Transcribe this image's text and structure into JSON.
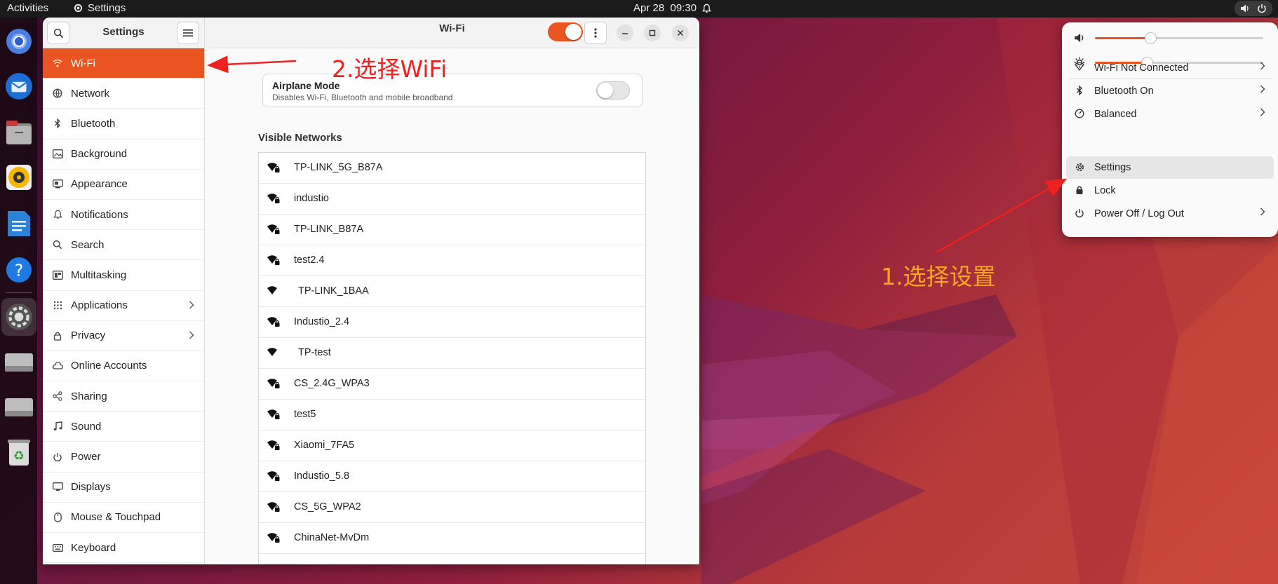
{
  "colors": {
    "accent": "#e95420",
    "annotation_red": "#ee2020",
    "annotation_yellow": "#f5a623"
  },
  "topbar": {
    "activities": "Activities",
    "app_name": "Settings",
    "clock": "Apr 28  09:30"
  },
  "dock": {
    "items": [
      "chromium-icon",
      "thunderbird-icon",
      "files-icon",
      "rhythmbox-icon",
      "writer-icon",
      "help-icon",
      "settings-icon",
      "drive-icon",
      "drive-icon",
      "trash-icon"
    ]
  },
  "settings": {
    "sidebar_title": "Settings",
    "nav": [
      {
        "label": "Wi-Fi",
        "icon": "wifi-icon",
        "active": true
      },
      {
        "label": "Network",
        "icon": "network-icon"
      },
      {
        "label": "Bluetooth",
        "icon": "bluetooth-icon"
      },
      {
        "label": "Background",
        "icon": "background-icon"
      },
      {
        "label": "Appearance",
        "icon": "appearance-icon"
      },
      {
        "label": "Notifications",
        "icon": "bell-icon"
      },
      {
        "label": "Search",
        "icon": "search-icon"
      },
      {
        "label": "Multitasking",
        "icon": "multitasking-icon"
      },
      {
        "label": "Applications",
        "icon": "grid-icon",
        "chevron": true
      },
      {
        "label": "Privacy",
        "icon": "lock-icon",
        "chevron": true
      },
      {
        "label": "Online Accounts",
        "icon": "cloud-icon"
      },
      {
        "label": "Sharing",
        "icon": "share-icon"
      },
      {
        "label": "Sound",
        "icon": "music-icon"
      },
      {
        "label": "Power",
        "icon": "power-icon"
      },
      {
        "label": "Displays",
        "icon": "display-icon"
      },
      {
        "label": "Mouse & Touchpad",
        "icon": "mouse-icon"
      },
      {
        "label": "Keyboard",
        "icon": "keyboard-icon"
      }
    ],
    "main_title": "Wi-Fi",
    "wifi_enabled": true,
    "airplane": {
      "title": "Airplane Mode",
      "subtitle": "Disables Wi-Fi, Bluetooth and mobile broadband",
      "enabled": false
    },
    "visible_networks_title": "Visible Networks",
    "networks": [
      {
        "name": "TP-LINK_5G_B87A",
        "secured": true
      },
      {
        "name": "industio",
        "secured": true
      },
      {
        "name": "TP-LINK_B87A",
        "secured": true
      },
      {
        "name": "test2.4",
        "secured": true
      },
      {
        "name": "TP-LINK_1BAA",
        "secured": false
      },
      {
        "name": "Industio_2.4",
        "secured": true
      },
      {
        "name": "TP-test",
        "secured": false
      },
      {
        "name": "CS_2.4G_WPA3",
        "secured": true
      },
      {
        "name": "test5",
        "secured": true
      },
      {
        "name": "Xiaomi_7FA5",
        "secured": true
      },
      {
        "name": "Industio_5.8",
        "secured": true
      },
      {
        "name": "CS_5G_WPA2",
        "secured": true
      },
      {
        "name": "ChinaNet-MvDm",
        "secured": true
      }
    ]
  },
  "quick_settings": {
    "volume_level": 0.33,
    "brightness_level": 0.31,
    "items": [
      {
        "label": "Wi-Fi Not Connected",
        "icon": "wifi-outline-icon",
        "chevron": true
      },
      {
        "label": "Bluetooth On",
        "icon": "bluetooth-icon",
        "chevron": true
      },
      {
        "label": "Balanced",
        "icon": "power-profile-icon",
        "chevron": true
      },
      {
        "label": "Settings",
        "icon": "gear-icon",
        "chevron": false
      },
      {
        "label": "Lock",
        "icon": "lock-icon",
        "chevron": false
      },
      {
        "label": "Power Off / Log Out",
        "icon": "power-icon",
        "chevron": true
      }
    ]
  },
  "annotations": {
    "step1": "1.选择设置",
    "step2": "2.选择WiFi"
  }
}
